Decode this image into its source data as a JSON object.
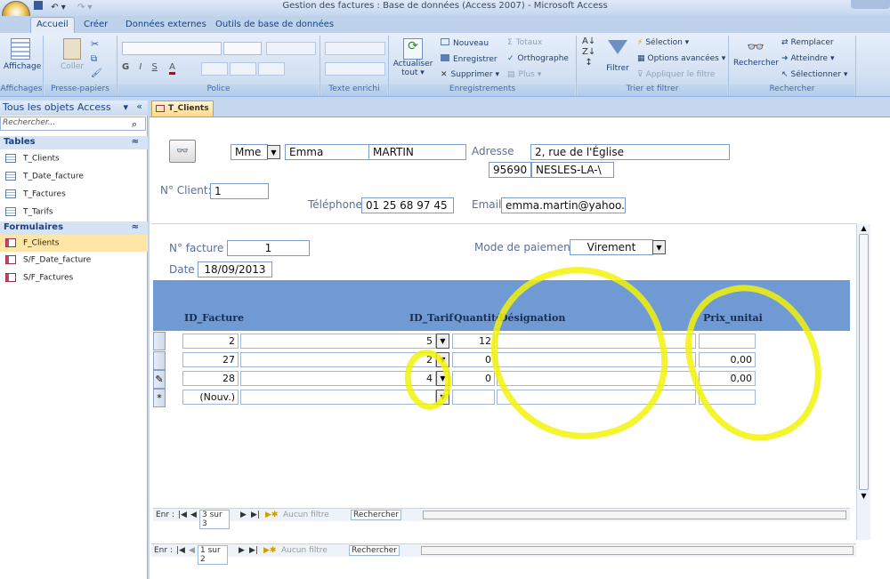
{
  "window": {
    "title": "Gestion des factures : Base de données (Access 2007) - Microsoft Access"
  },
  "tabs": [
    "Accueil",
    "Créer",
    "Données externes",
    "Outils de base de données"
  ],
  "ribbon": {
    "groups": [
      "Affichages",
      "Presse-papiers",
      "Police",
      "Texte enrichi",
      "Enregistrements",
      "Trier et filtrer",
      "Rechercher"
    ],
    "affichage": "Affichage",
    "coller": "Coller",
    "actualiser": "Actualiser",
    "actualiser2": "tout",
    "nouveau": "Nouveau",
    "enregistrer": "Enregistrer",
    "supprimer": "Supprimer",
    "totaux": "Totaux",
    "orthographe": "Orthographe",
    "plus": "Plus",
    "filtrer": "Filtrer",
    "selection": "Sélection",
    "options_avancees": "Options avancées",
    "appliquer_filtre": "Appliquer le filtre",
    "rechercher": "Rechercher",
    "remplacer": "Remplacer",
    "atteindre": "Atteindre",
    "selectionner": "Sélectionner",
    "font_buttons": [
      "G",
      "I",
      "S",
      "A"
    ]
  },
  "nav": {
    "header": "Tous les objets Access",
    "search_placeholder": "Rechercher...",
    "sections": [
      {
        "title": "Tables",
        "items": [
          "T_Clients",
          "T_Date_facture",
          "T_Factures",
          "T_Tarifs"
        ]
      },
      {
        "title": "Formulaires",
        "items": [
          "F_Clients",
          "S/F_Date_facture",
          "S/F_Factures"
        ]
      }
    ]
  },
  "document_tab": "T_Clients",
  "client": {
    "civilite": "Mme",
    "prenom": "Emma",
    "nom": "MARTIN",
    "adresse_label": "Adresse",
    "adresse": "2, rue de l'Église",
    "cp": "95690",
    "ville": "NESLES-LA-\\",
    "no_client_label": "N° Client:",
    "no_client": "1",
    "telephone_label": "Téléphone",
    "telephone": "01 25 68 97 45",
    "email_label": "Email",
    "email": "emma.martin@yahoo.f"
  },
  "facture": {
    "no_label": "N° facture",
    "no": "1",
    "date_label": "Date",
    "date": "18/09/2013",
    "mode_label": "Mode de paiement",
    "mode": "Virement"
  },
  "grid": {
    "headers": {
      "id_facture": "ID_Facture",
      "id_tarif": "ID_Tarif",
      "quantite": "Quantité",
      "designation": "Désignation",
      "prix": "Prix_unitai"
    },
    "rows": [
      {
        "selector": "",
        "id": "2",
        "tarif": "5",
        "qte": "12",
        "des": "",
        "prix": ""
      },
      {
        "selector": "",
        "id": "27",
        "tarif": "2",
        "qte": "0",
        "des": "",
        "prix": "0,00"
      },
      {
        "selector": "✎",
        "id": "28",
        "tarif": "4",
        "qte": "0",
        "des": "",
        "prix": "0,00"
      },
      {
        "selector": "*",
        "id": "(Nouv.)",
        "tarif": "",
        "qte": "",
        "des": "",
        "prix": ""
      }
    ]
  },
  "subnav": {
    "label": "Enr :",
    "pos": "3 sur 3",
    "filter": "Aucun filtre",
    "search": "Rechercher"
  },
  "mainnav": {
    "label": "Enr :",
    "pos": "1 sur 2",
    "filter": "Aucun filtre",
    "search": "Rechercher"
  },
  "colors": {
    "accent": "#6f9ad3",
    "highlight": "#f2f20a"
  }
}
